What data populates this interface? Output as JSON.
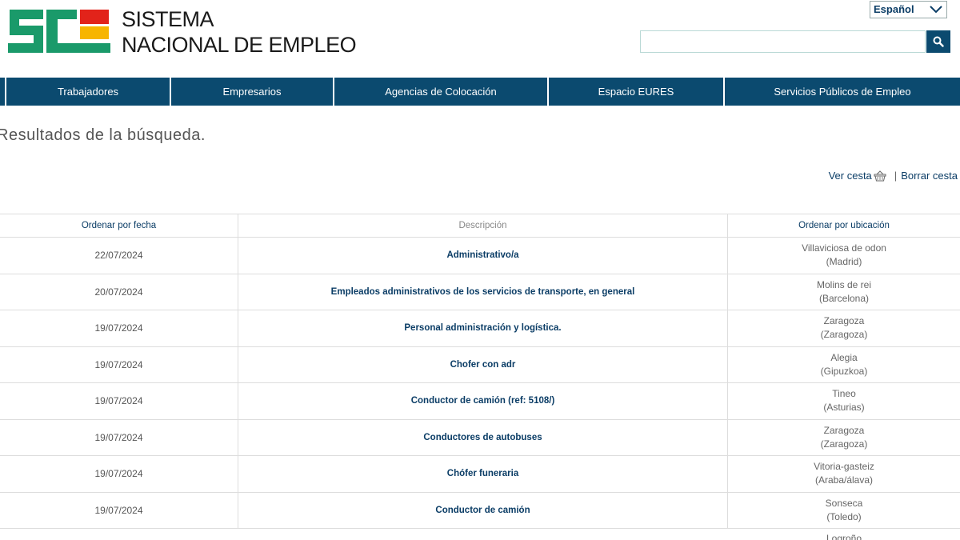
{
  "header": {
    "brand_line1": "SISTEMA",
    "brand_line2": "NACIONAL DE EMPLEO",
    "language": "Español",
    "search_placeholder": ""
  },
  "nav": {
    "items": [
      {
        "label": "Trabajadores"
      },
      {
        "label": "Empresarios"
      },
      {
        "label": "Agencias de Colocación"
      },
      {
        "label": "Espacio EURES"
      },
      {
        "label": "Servicios Públicos de Empleo"
      }
    ]
  },
  "main": {
    "title": "Resultados de la búsqueda.",
    "basket": {
      "view_label": "Ver cesta",
      "separator": "|",
      "clear_label": "Borrar cesta"
    },
    "table": {
      "headers": {
        "date": "Ordenar por fecha",
        "description": "Descripción",
        "location": "Ordenar por ubicación"
      },
      "rows": [
        {
          "date": "22/07/2024",
          "description": "Administrativo/a",
          "city": "Villaviciosa de odon",
          "province": "(Madrid)"
        },
        {
          "date": "20/07/2024",
          "description": "Empleados administrativos de los servicios de transporte, en general",
          "city": "Molins de rei",
          "province": "(Barcelona)"
        },
        {
          "date": "19/07/2024",
          "description": "Personal administración y logística.",
          "city": "Zaragoza",
          "province": "(Zaragoza)"
        },
        {
          "date": "19/07/2024",
          "description": "Chofer con adr",
          "city": "Alegia",
          "province": "(Gipuzkoa)"
        },
        {
          "date": "19/07/2024",
          "description": "Conductor de camión (ref: 5108/)",
          "city": "Tineo",
          "province": "(Asturias)"
        },
        {
          "date": "19/07/2024",
          "description": "Conductores de autobuses",
          "city": "Zaragoza",
          "province": "(Zaragoza)"
        },
        {
          "date": "19/07/2024",
          "description": "Chófer funeraria",
          "city": "Vitoria-gasteiz",
          "province": "(Araba/álava)"
        },
        {
          "date": "19/07/2024",
          "description": "Conductor de camión",
          "city": "Sonseca",
          "province": "(Toledo)"
        },
        {
          "date": "",
          "description": "",
          "city": "Logroño",
          "province": ""
        }
      ]
    }
  },
  "colors": {
    "nav_bg": "#0b4a6f",
    "link": "#0b3d66",
    "logo_green": "#1a9a6a",
    "logo_red": "#e2231a",
    "logo_yellow": "#f7b500"
  }
}
